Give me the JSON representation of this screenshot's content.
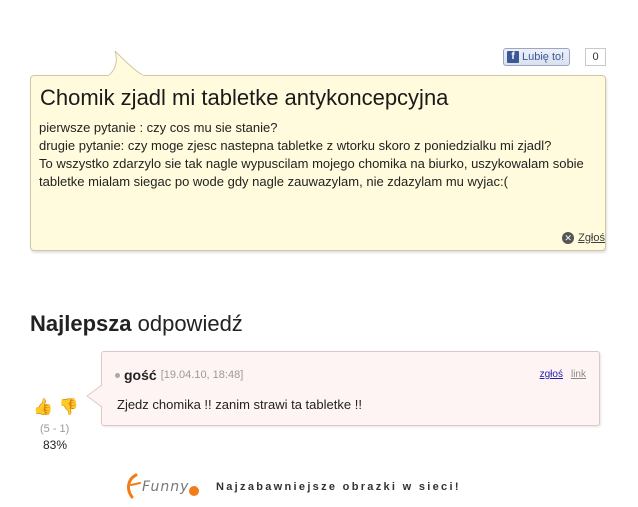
{
  "like_widget": {
    "label": "Lubię to!",
    "count": "0",
    "icon_glyph": "f"
  },
  "question": {
    "title": "Chomik zjadl mi tabletke antykoncepcyjna",
    "lines": [
      "pierwsze pytanie : czy cos mu sie stanie?",
      "drugie pytanie: czy moge zjesc nastepna tabletke z wtorku skoro z poniedzialku mi zjadl?",
      "To wszystko zdarzylo sie tak nagle wypuscilam mojego chomika na biurko, uszykowalam sobie tabletke mialam siegac po wode gdy nagle zauwazylam, nie zdazylam mu wyjac:("
    ],
    "report_label": "Zgłoś",
    "report_icon_glyph": "✕"
  },
  "best_answer": {
    "heading_bold": "Najlepsza",
    "heading_rest": " odpowiedź",
    "author": "gość",
    "date": "[19.04.10, 18:48]",
    "report_link": "zgłoś",
    "link_label": "link",
    "text": "Zjedz chomika !! zanim strawi ta tabletke !!"
  },
  "votes": {
    "up_icon": "👍",
    "down_icon": "👎",
    "detail": "(5 - 1)",
    "percent": "83%"
  },
  "footer": {
    "logo_text": "Funny",
    "tagline": "Najzabawniejsze obrazki w sieci!"
  },
  "colors": {
    "question_bg": "#fffbdc",
    "answer_bg": "#fff4f4",
    "facebook_blue": "#3b5998",
    "logo_orange": "#f07c1a"
  }
}
